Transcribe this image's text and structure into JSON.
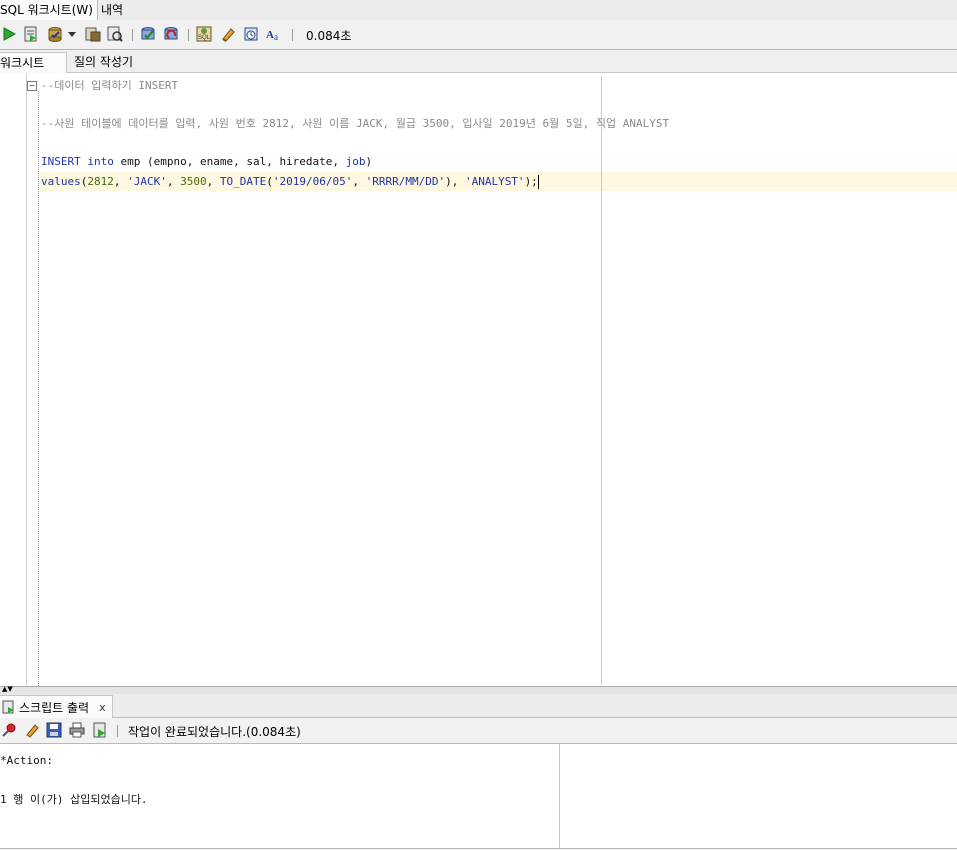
{
  "top_tabs": {
    "sql_worksheet": "SQL 워크시트(W)",
    "history": "내역"
  },
  "toolbar": {
    "elapsed": "0.084초",
    "icons": [
      "run-statement-icon",
      "run-script-icon",
      "commit-icon",
      "dropdown-arrow-icon",
      "explain-plan-icon",
      "autotrace-icon",
      "commit-icon",
      "rollback-icon",
      "sql-tuning-icon",
      "clear-icon",
      "history-icon",
      "format-icon"
    ]
  },
  "sub_tabs": {
    "worksheet": "워크시트",
    "query_builder": "질의 작성기"
  },
  "editor": {
    "line1": "--데이터 입력하기 INSERT",
    "line3": "--사원 테이블에 데이터를 입력, 사원 번호 2812, 사원 이름 JACK, 월급 3500, 입사일 2019년 6월 5일, 직업 ANALYST",
    "line5": {
      "kw_insert": "INSERT",
      "kw_into": "into",
      "rest": " emp (empno, ename, sal, hiredate, ",
      "kw_job": "job",
      "close": ")"
    },
    "line6": {
      "values": "values",
      "open": "(",
      "n1": "2812",
      "c1": ", ",
      "s1": "'JACK'",
      "c2": ", ",
      "n2": "3500",
      "c3": ", ",
      "fn": "TO_DATE",
      "open2": "(",
      "s2": "'2019/06/05'",
      "c4": ", ",
      "s3": "'RRRR/MM/DD'",
      "close2": ")",
      "c5": ", ",
      "s4": "'ANALYST'",
      "end": ");"
    }
  },
  "output_panel": {
    "tab_label": "스크립트 출력",
    "close": "x",
    "status": "작업이 완료되었습니다.(0.084초)",
    "lines": [
      "*Action:",
      "1 행 이(가) 삽입되었습니다."
    ]
  },
  "colors": {
    "keyword": "#1f33a3",
    "comment": "#8a8a8a",
    "number": "#486d12",
    "current_line": "#fff8e0"
  }
}
